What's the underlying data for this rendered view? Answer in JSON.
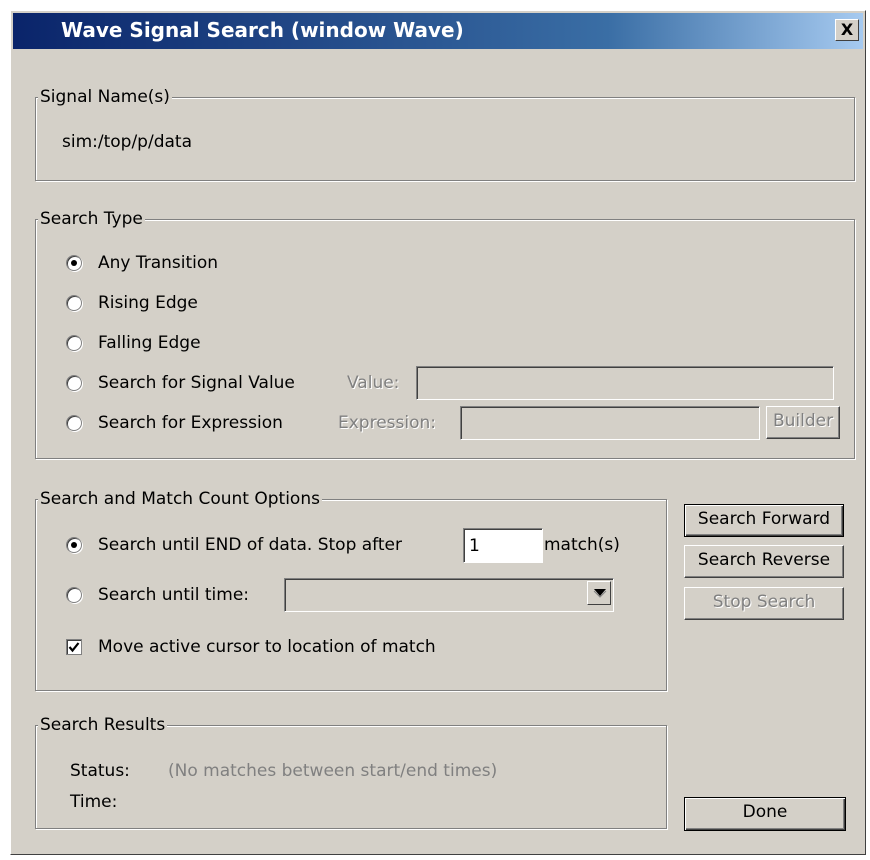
{
  "window": {
    "title": "Wave Signal Search (window Wave)",
    "close_label": "X"
  },
  "signal_names": {
    "legend": "Signal Name(s)",
    "value": "sim:/top/p/data"
  },
  "search_type": {
    "legend": "Search Type",
    "options": [
      {
        "label": "Any Transition",
        "selected": true
      },
      {
        "label": "Rising Edge",
        "selected": false
      },
      {
        "label": "Falling Edge",
        "selected": false
      },
      {
        "label": "Search for Signal Value",
        "selected": false
      },
      {
        "label": "Search for Expression",
        "selected": false
      }
    ],
    "value_label": "Value:",
    "value_field": "",
    "expression_label": "Expression:",
    "expression_field": "",
    "builder_label": "Builder"
  },
  "match_options": {
    "legend": "Search and Match Count Options",
    "until_end_label": "Search until END of data. Stop after",
    "stop_after_value": "1",
    "matches_label": "match(s)",
    "until_time_label": "Search until time:",
    "until_time_value": "",
    "move_cursor_label": "Move active cursor to location of match",
    "move_cursor_checked": true,
    "selected": "until_end"
  },
  "buttons": {
    "search_forward": "Search Forward",
    "search_reverse": "Search Reverse",
    "stop_search": "Stop Search",
    "done": "Done"
  },
  "results": {
    "legend": "Search Results",
    "status_label": "Status:",
    "status_value": "(No matches between start/end times)",
    "time_label": "Time:",
    "time_value": ""
  },
  "icons": {
    "radio": "radio-button-icon",
    "checkbox": "checkmark-icon",
    "dropdown": "chevron-down-icon"
  }
}
